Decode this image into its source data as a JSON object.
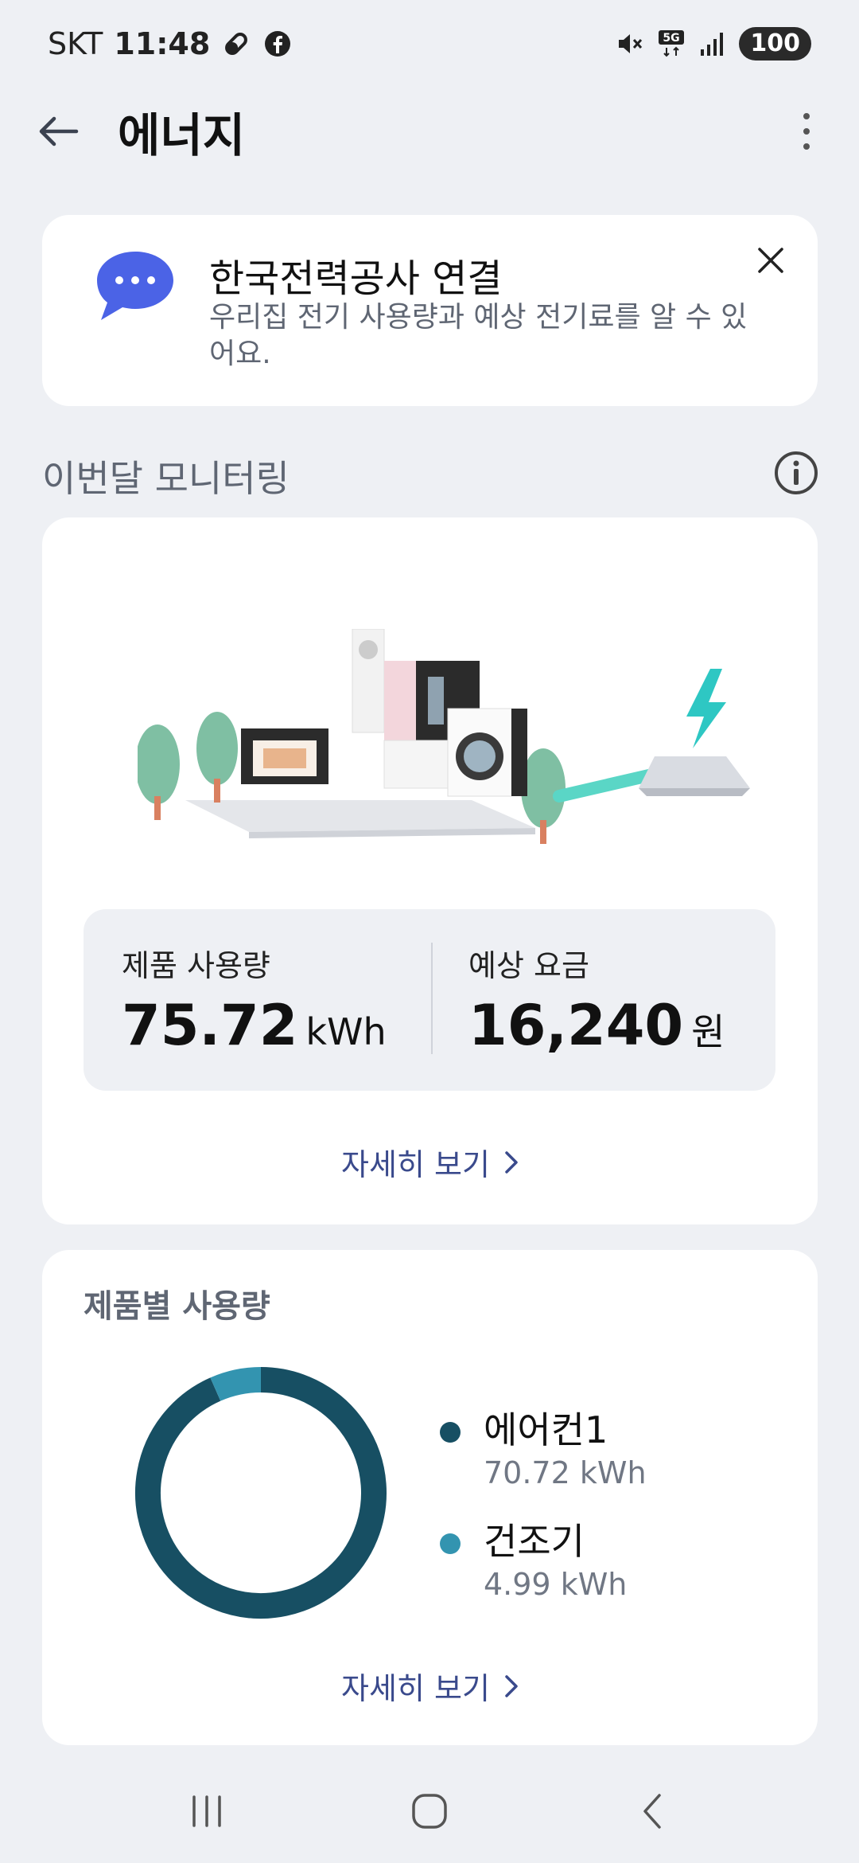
{
  "status_bar": {
    "carrier": "SKT",
    "time": "11:48",
    "network": "5G",
    "battery": "100"
  },
  "app_bar": {
    "title": "에너지"
  },
  "kepco_banner": {
    "title": "한국전력공사 연결",
    "description": "우리집 전기 사용량과 예상 전기료를 알 수 있어요."
  },
  "monitoring": {
    "section_title": "이번달 모니터링",
    "usage_label": "제품 사용량",
    "usage_value": "75.72",
    "usage_unit": "kWh",
    "fee_label": "예상 요금",
    "fee_value": "16,240",
    "fee_unit": "원",
    "detail_label": "자세히 보기"
  },
  "product_usage": {
    "title": "제품별 사용량",
    "detail_label": "자세히 보기",
    "items": [
      {
        "name": "에어컨1",
        "value": "70.72 kWh",
        "amount": 70.72,
        "color": "#174f63"
      },
      {
        "name": "건조기",
        "value": "4.99 kWh",
        "amount": 4.99,
        "color": "#3394b0"
      }
    ]
  },
  "colors": {
    "accent_link": "#3a4a8c",
    "chat_icon": "#4b63e6",
    "lightning": "#2ec7c3"
  }
}
